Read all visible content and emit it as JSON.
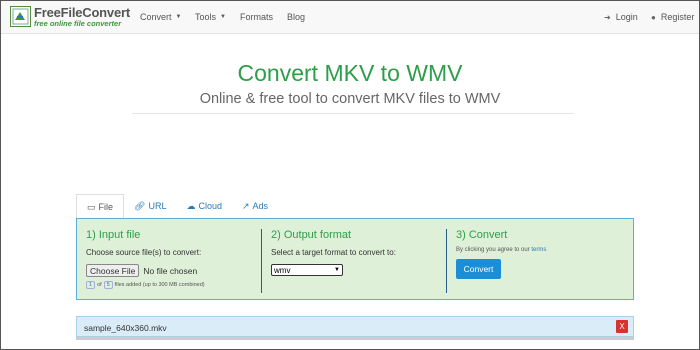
{
  "navbar": {
    "logo_title": "FreeFileConvert",
    "logo_sub": "free online file converter",
    "items": [
      {
        "label": "Convert",
        "dropdown": true
      },
      {
        "label": "Tools",
        "dropdown": true
      },
      {
        "label": "Formats",
        "dropdown": false
      },
      {
        "label": "Blog",
        "dropdown": false
      }
    ],
    "login_label": "Login",
    "register_label": "Register"
  },
  "hero": {
    "title": "Convert MKV to WMV",
    "subtitle": "Online & free tool to convert MKV files to WMV"
  },
  "tabs": [
    {
      "label": "File",
      "icon": "monitor-icon",
      "active": true
    },
    {
      "label": "URL",
      "icon": "link-icon",
      "active": false
    },
    {
      "label": "Cloud",
      "icon": "cloud-icon",
      "active": false
    },
    {
      "label": "Ads",
      "icon": "external-link-icon",
      "active": false
    }
  ],
  "panel": {
    "input": {
      "title": "1) Input file",
      "instruction": "Choose source file(s) to convert:",
      "choose_button": "Choose File",
      "no_file_text": "No file chosen",
      "count_current": "1",
      "count_sep": "of",
      "count_max": "5",
      "count_suffix": "files added (up to 300 MB combined)"
    },
    "output": {
      "title": "2) Output format",
      "instruction": "Select a target format to convert to:",
      "selected_format": "wmv"
    },
    "convert": {
      "title": "3) Convert",
      "terms_prefix": "By clicking you agree to our",
      "terms_link": "terms",
      "button_label": "Convert"
    }
  },
  "file_item": {
    "name": "sample_640x360.mkv",
    "remove_label": "X"
  },
  "colors": {
    "accent_green": "#2e9e4a",
    "link_blue": "#2a7ab8",
    "panel_bg": "#dff0d8",
    "button_blue": "#1a8fd8",
    "remove_red": "#d9312b"
  }
}
